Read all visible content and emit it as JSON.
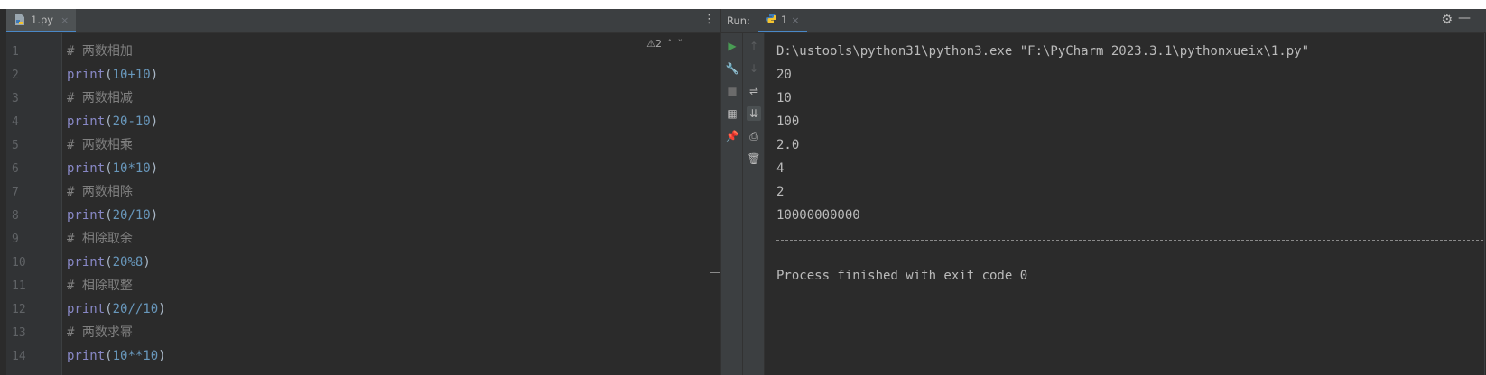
{
  "editor": {
    "tab": {
      "label": "1.py",
      "close": "×",
      "icon": "python-file-icon"
    },
    "menu_dots": "⋮",
    "inspections": {
      "warning_icon": "warning-icon",
      "warning_count": "⚠2",
      "up": "˄",
      "down": "˅"
    },
    "lines": [
      {
        "n": "1",
        "text": "# 两数相加",
        "kind": "comment"
      },
      {
        "n": "2",
        "text": "print(10+10)",
        "kind": "code",
        "fn": "print",
        "args": "10+10"
      },
      {
        "n": "3",
        "text": "# 两数相减",
        "kind": "comment"
      },
      {
        "n": "4",
        "text": "print(20-10)",
        "kind": "code",
        "fn": "print",
        "args": "20-10"
      },
      {
        "n": "5",
        "text": "# 两数相乘",
        "kind": "comment"
      },
      {
        "n": "6",
        "text": "print(10*10)",
        "kind": "code",
        "fn": "print",
        "args": "10*10"
      },
      {
        "n": "7",
        "text": "# 两数相除",
        "kind": "comment"
      },
      {
        "n": "8",
        "text": "print(20/10)",
        "kind": "code",
        "fn": "print",
        "args": "20/10"
      },
      {
        "n": "9",
        "text": "# 相除取余",
        "kind": "comment"
      },
      {
        "n": "10",
        "text": "print(20%8)",
        "kind": "code",
        "fn": "print",
        "args": "20%8"
      },
      {
        "n": "11",
        "text": "# 相除取整",
        "kind": "comment"
      },
      {
        "n": "12",
        "text": "print(20//10)",
        "kind": "code",
        "fn": "print",
        "args": "20//10"
      },
      {
        "n": "13",
        "text": "# 两数求幂",
        "kind": "comment"
      },
      {
        "n": "14",
        "text": "print(10**10)",
        "kind": "code",
        "fn": "print",
        "args": "10**10"
      }
    ]
  },
  "run": {
    "label": "Run:",
    "tab": {
      "label": "1",
      "close": "×",
      "icon": "python-run-icon"
    },
    "settings_icon": "gear-icon",
    "minimize_icon": "minimize-icon",
    "toolbar_left": [
      {
        "icon": "rerun-icon",
        "glyph": "▶",
        "color": "#499c54"
      },
      {
        "icon": "wrench-icon",
        "glyph": "🔧",
        "color": "#bbbbbb"
      },
      {
        "icon": "stop-icon",
        "glyph": "■",
        "color": "#6b6b6b"
      },
      {
        "icon": "layout-icon",
        "glyph": "▦",
        "color": "#bbbbbb"
      },
      {
        "icon": "pin-icon",
        "glyph": "📌",
        "color": "#bbbbbb"
      }
    ],
    "toolbar_right": [
      {
        "icon": "up-arrow-icon",
        "glyph": "↑",
        "color": "#5a5d5f"
      },
      {
        "icon": "down-arrow-icon",
        "glyph": "↓",
        "color": "#5a5d5f"
      },
      {
        "icon": "soft-wrap-icon",
        "glyph": "⇌",
        "color": "#bbbbbb"
      },
      {
        "icon": "scroll-to-end-icon",
        "glyph": "⇊",
        "color": "#bbbbbb"
      },
      {
        "icon": "print-icon",
        "glyph": "⎙",
        "color": "#bbbbbb"
      },
      {
        "icon": "trash-icon",
        "glyph": "🗑",
        "color": "#bbbbbb"
      }
    ],
    "output": [
      "D:\\ustools\\python31\\python3.exe \"F:\\PyCharm 2023.3.1\\pythonxueix\\1.py\"",
      "20",
      "10",
      "100",
      "2.0",
      "4",
      "2",
      "10000000000"
    ],
    "finished": "Process finished with exit code 0"
  },
  "colors": {
    "background": "#2b2b2b",
    "comment": "#808080",
    "function": "#8888c6",
    "number": "#6897bb",
    "text": "#a9b7c6",
    "accent": "#4a88c7"
  }
}
